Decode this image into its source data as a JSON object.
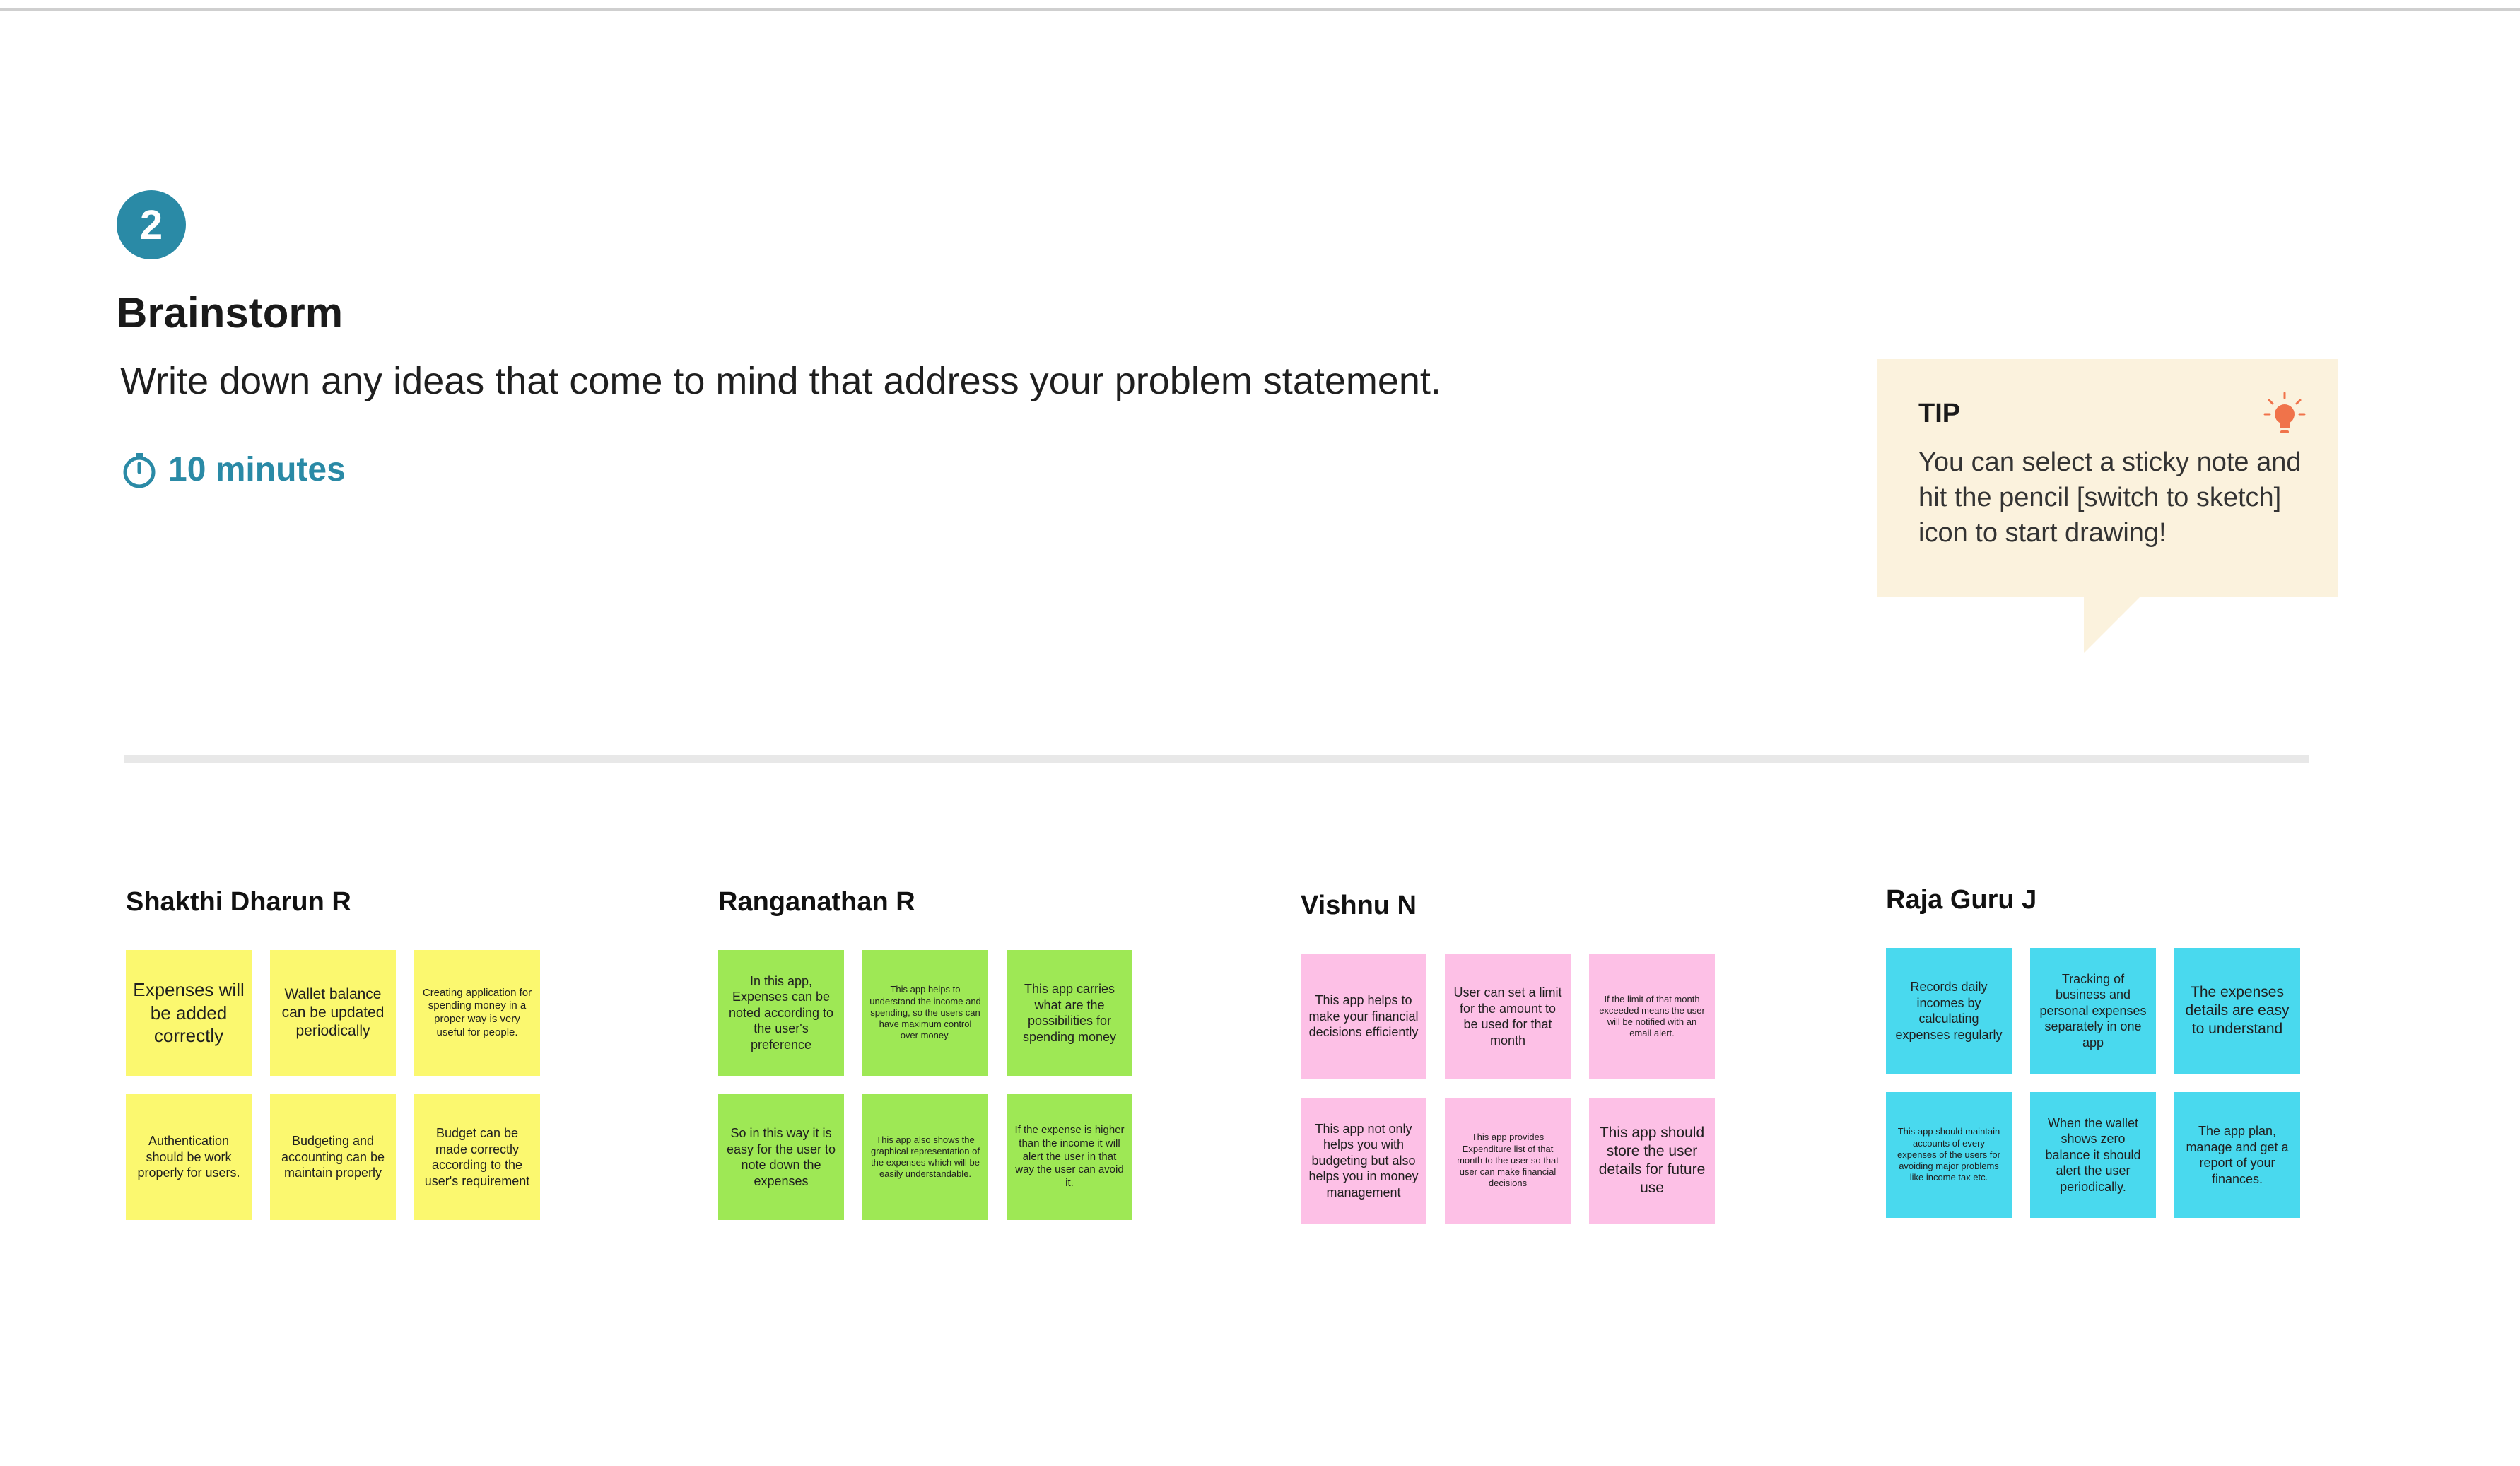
{
  "step": {
    "number": "2"
  },
  "header": {
    "title": "Brainstorm",
    "subtitle": "Write down any ideas that come to mind that address your problem statement.",
    "timer": "10 minutes"
  },
  "tip": {
    "heading": "TIP",
    "body": "You can select a sticky note and hit the pencil [switch to sketch] icon to start drawing!",
    "icon": "lightbulb-icon"
  },
  "colors": {
    "accent": "#2a8aa6",
    "tip_bg": "#fbf2dd",
    "yellow": "#fbf86f",
    "green": "#9ee855",
    "pink": "#fdc0e6",
    "blue": "#49d9ee"
  },
  "groups": [
    {
      "name": "Shakthi Dharun R",
      "notes": [
        "Expenses will be added correctly",
        "Wallet balance can be updated periodically",
        "Creating application for spending money in a proper way is very useful for people.",
        "Authentication should be work properly for users.",
        "Budgeting and accounting can be maintain properly",
        "Budget can be made correctly according to the user's requirement"
      ]
    },
    {
      "name": "Ranganathan R",
      "notes": [
        "In this app, Expenses can be noted according to the user's preference",
        "This app helps to understand the income and spending, so the users can have maximum control over money.",
        "This app carries what are the possibilities for spending money",
        "So in this way it is easy for the user to note down the expenses",
        "This app also shows the graphical representation of the expenses which will be easily understandable.",
        "If the expense is higher than the income it will alert the user in that way the user can avoid it."
      ]
    },
    {
      "name": "Vishnu N",
      "notes": [
        "This app helps to make your financial decisions efficiently",
        "User can set a limit for the amount to be used for that month",
        "If the limit of that month exceeded means  the user will be notified with an email alert.",
        "This app not only helps you with budgeting but also helps you in money management",
        "This app provides Expenditure list of that month to  the user so that user can make financial decisions",
        "This app should store the user details for future use"
      ]
    },
    {
      "name": "Raja Guru J",
      "notes": [
        "Records daily incomes by calculating expenses regularly",
        "Tracking of business and personal expenses separately in one app",
        "The expenses details are easy to understand",
        "This app should maintain accounts of every expenses of the users for avoiding major problems like income tax etc.",
        "When the wallet shows zero balance it should alert the user periodically.",
        "The app plan, manage and get a report of your finances."
      ]
    }
  ]
}
